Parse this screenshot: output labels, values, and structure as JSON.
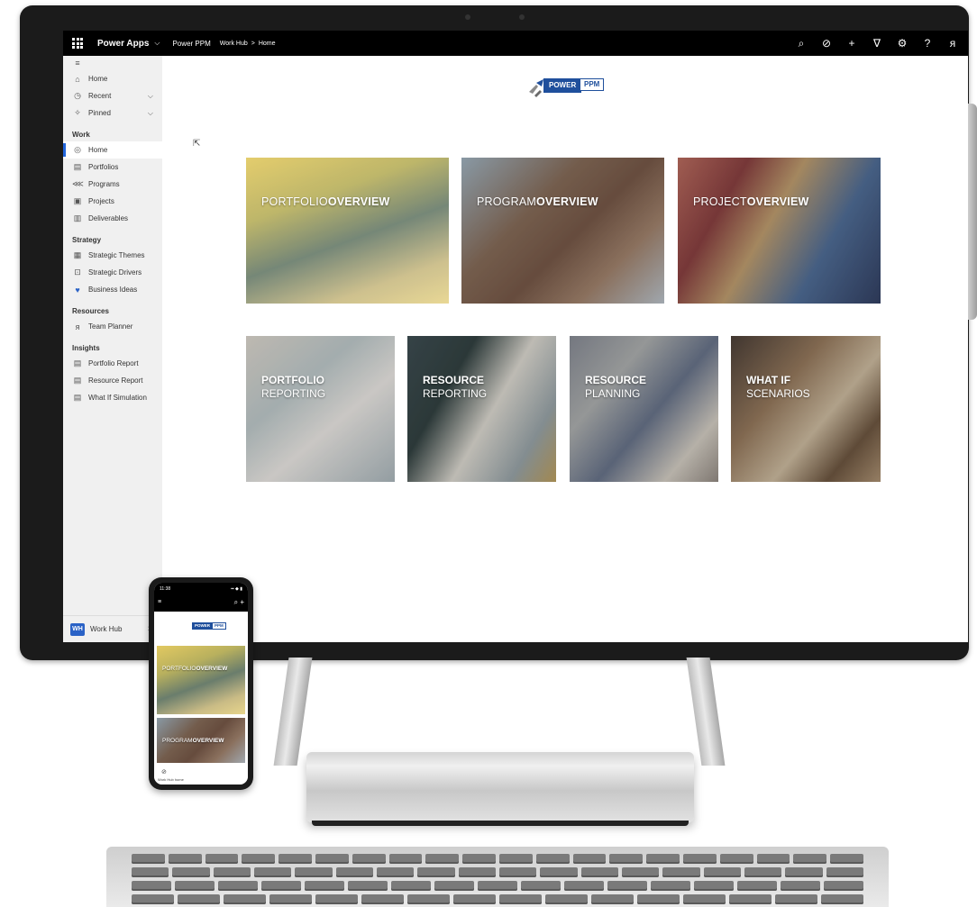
{
  "topbar": {
    "app_name": "Power Apps",
    "app_chevron": "⌵",
    "app_link": "Power PPM",
    "breadcrumb": [
      "Work Hub",
      "Home"
    ],
    "breadcrumb_separator": ">",
    "icons": [
      "search-icon",
      "task-icon",
      "add-icon",
      "filter-icon",
      "settings-icon",
      "help-icon",
      "user-icon"
    ]
  },
  "sidebar": {
    "menu_icon": "hamburger-icon",
    "top_items": [
      {
        "label": "Home",
        "icon": "home-icon"
      },
      {
        "label": "Recent",
        "icon": "clock-icon",
        "chevron": true
      },
      {
        "label": "Pinned",
        "icon": "pin-icon",
        "chevron": true
      }
    ],
    "groups": [
      {
        "title": "Work",
        "items": [
          {
            "label": "Home",
            "icon": "home-circle-icon",
            "active": true
          },
          {
            "label": "Portfolios",
            "icon": "portfolio-icon"
          },
          {
            "label": "Programs",
            "icon": "hierarchy-icon"
          },
          {
            "label": "Projects",
            "icon": "project-icon"
          },
          {
            "label": "Deliverables",
            "icon": "deliverable-icon"
          }
        ]
      },
      {
        "title": "Strategy",
        "items": [
          {
            "label": "Strategic Themes",
            "icon": "theme-icon"
          },
          {
            "label": "Strategic Drivers",
            "icon": "driver-icon"
          },
          {
            "label": "Business Ideas",
            "icon": "heart-icon"
          }
        ]
      },
      {
        "title": "Resources",
        "items": [
          {
            "label": "Team Planner",
            "icon": "person-icon"
          }
        ]
      },
      {
        "title": "Insights",
        "items": [
          {
            "label": "Portfolio Report",
            "icon": "report-icon"
          },
          {
            "label": "Resource Report",
            "icon": "report-icon"
          },
          {
            "label": "What If Simulation",
            "icon": "report-icon"
          }
        ]
      }
    ],
    "footer": {
      "badge": "WH",
      "label": "Work Hub",
      "icon": "up-down-icon"
    }
  },
  "main": {
    "logo": {
      "word1": "POWER",
      "word2": "PPM"
    },
    "overview_tiles": [
      {
        "pre": "PORTFOLIO",
        "bold": "OVERVIEW"
      },
      {
        "pre": "PROGRAM",
        "bold": "OVERVIEW"
      },
      {
        "pre": "PROJECT",
        "bold": "OVERVIEW"
      }
    ],
    "feature_tiles": [
      {
        "line1": "PORTFOLIO",
        "line2": "REPORTING"
      },
      {
        "line1": "RESOURCE",
        "line2": "REPORTING"
      },
      {
        "line1": "RESOURCE",
        "line2": "PLANNING"
      },
      {
        "line1": "WHAT IF",
        "line2": "SCENARIOS"
      }
    ]
  },
  "phone": {
    "time": "11:38",
    "status": "▪▪ ◆ ▮",
    "logo": {
      "word1": "POWER",
      "word2": "PPM"
    },
    "tiles": [
      {
        "pre": "PORTFOLIO",
        "bold": "OVERVIEW"
      },
      {
        "pre": "PROGRAM",
        "bold": "OVERVIEW"
      }
    ],
    "footer_label": "Work Hub\nhome"
  }
}
